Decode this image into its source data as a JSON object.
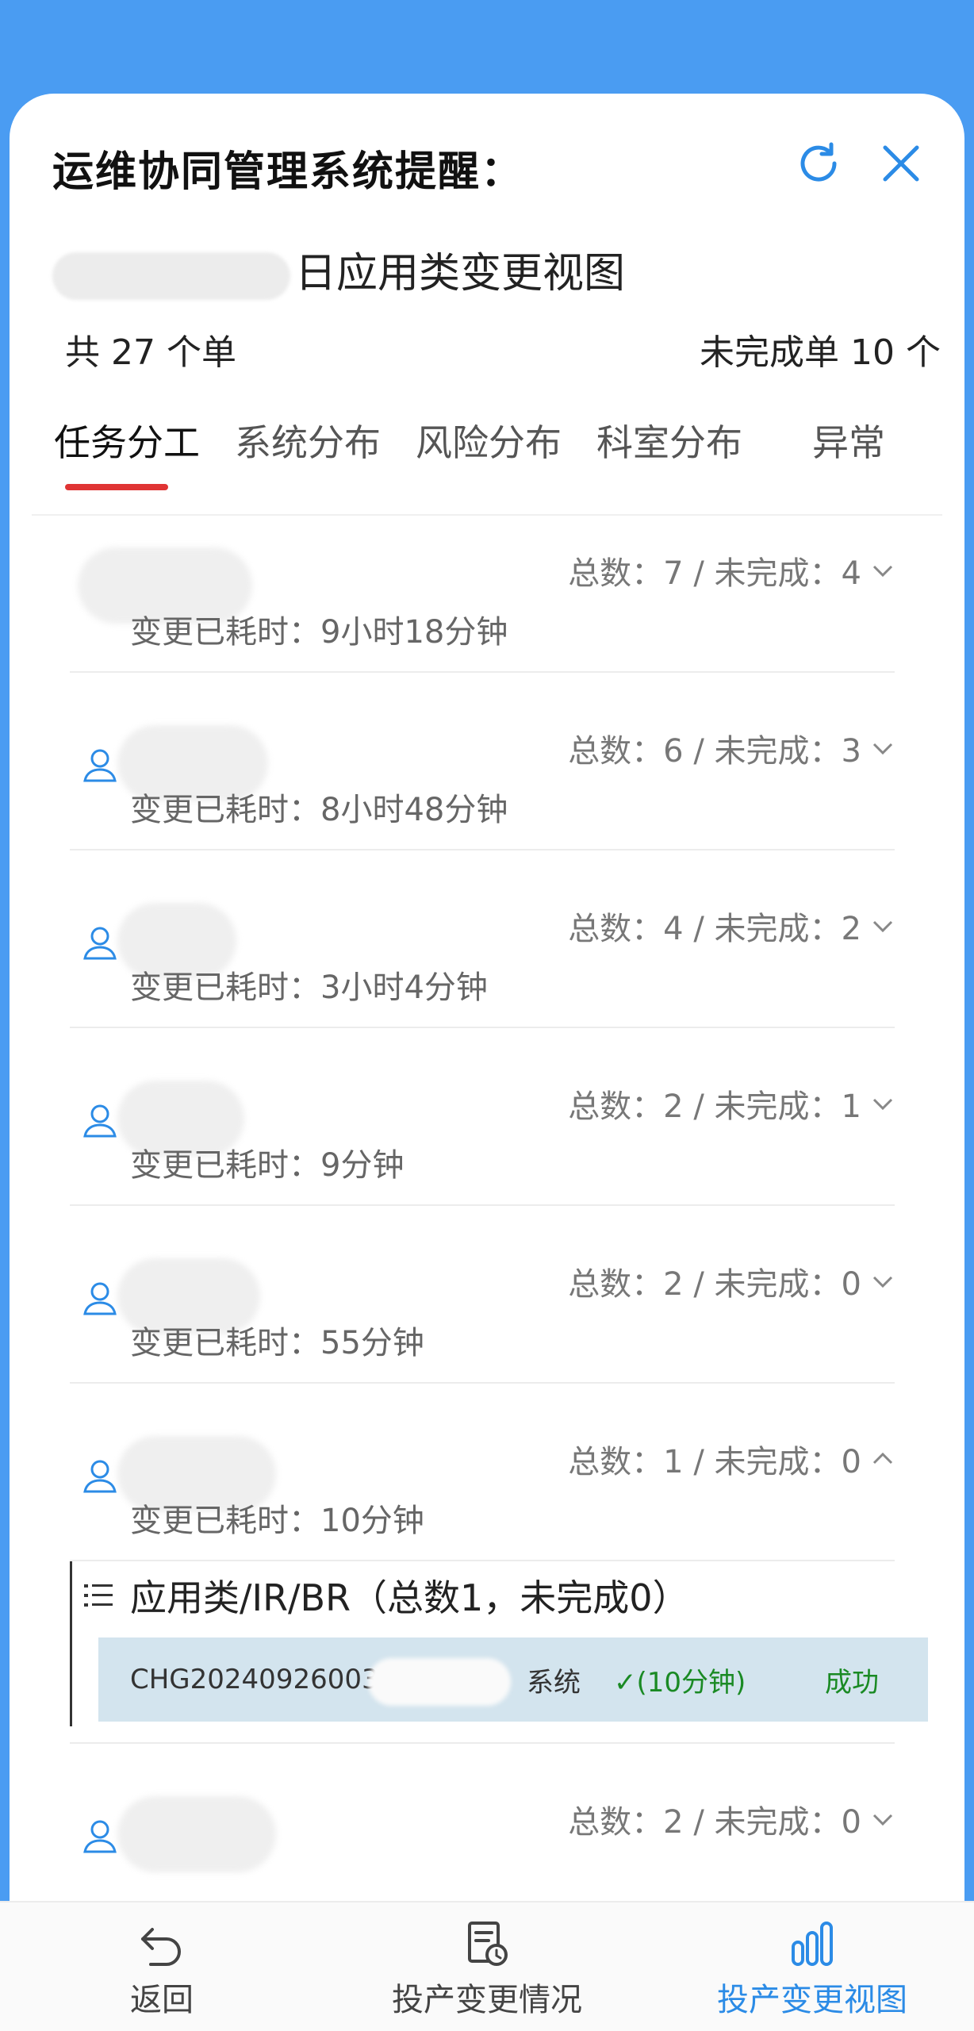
{
  "header": {
    "title": "运维协同管理系统提醒：",
    "subtitle_visible": "日应用类变更视图",
    "refresh_icon": "refresh-icon",
    "close_icon": "close-icon"
  },
  "summary": {
    "total": "共 27 个单",
    "incomplete": "未完成单 10 个"
  },
  "tabs": [
    {
      "label": "任务分工"
    },
    {
      "label": "系统分布"
    },
    {
      "label": "风险分布"
    },
    {
      "label": "科室分布"
    },
    {
      "label": "异常"
    }
  ],
  "rows": [
    {
      "counts": "总数：7 / 未完成：4",
      "elapsed": "变更已耗时：9小时18分钟"
    },
    {
      "counts": "总数：6 / 未完成：3",
      "elapsed": "变更已耗时：8小时48分钟"
    },
    {
      "counts": "总数：4 / 未完成：2",
      "elapsed": "变更已耗时：3小时4分钟"
    },
    {
      "counts": "总数：2 / 未完成：1",
      "elapsed": "变更已耗时：9分钟"
    },
    {
      "counts": "总数：2 / 未完成：0",
      "elapsed": "变更已耗时：55分钟"
    },
    {
      "counts": "总数：1 / 未完成：0",
      "elapsed": "变更已耗时：10分钟"
    }
  ],
  "detail": {
    "heading": "应用类/IR/BR（总数1，未完成0）",
    "code": "CHG20240926003",
    "system_suffix": "系统",
    "time": "✓(10分钟)",
    "status": "成功"
  },
  "last_row": {
    "counts": "总数：2 / 未完成：0"
  },
  "footer": {
    "back": "返回",
    "status": "投产变更情况",
    "view": "投产变更视图"
  },
  "colors": {
    "accent": "#2b8be6",
    "tab_underline": "#e03434",
    "success": "#1a8a24",
    "header_bg": "#4a9cf2"
  }
}
